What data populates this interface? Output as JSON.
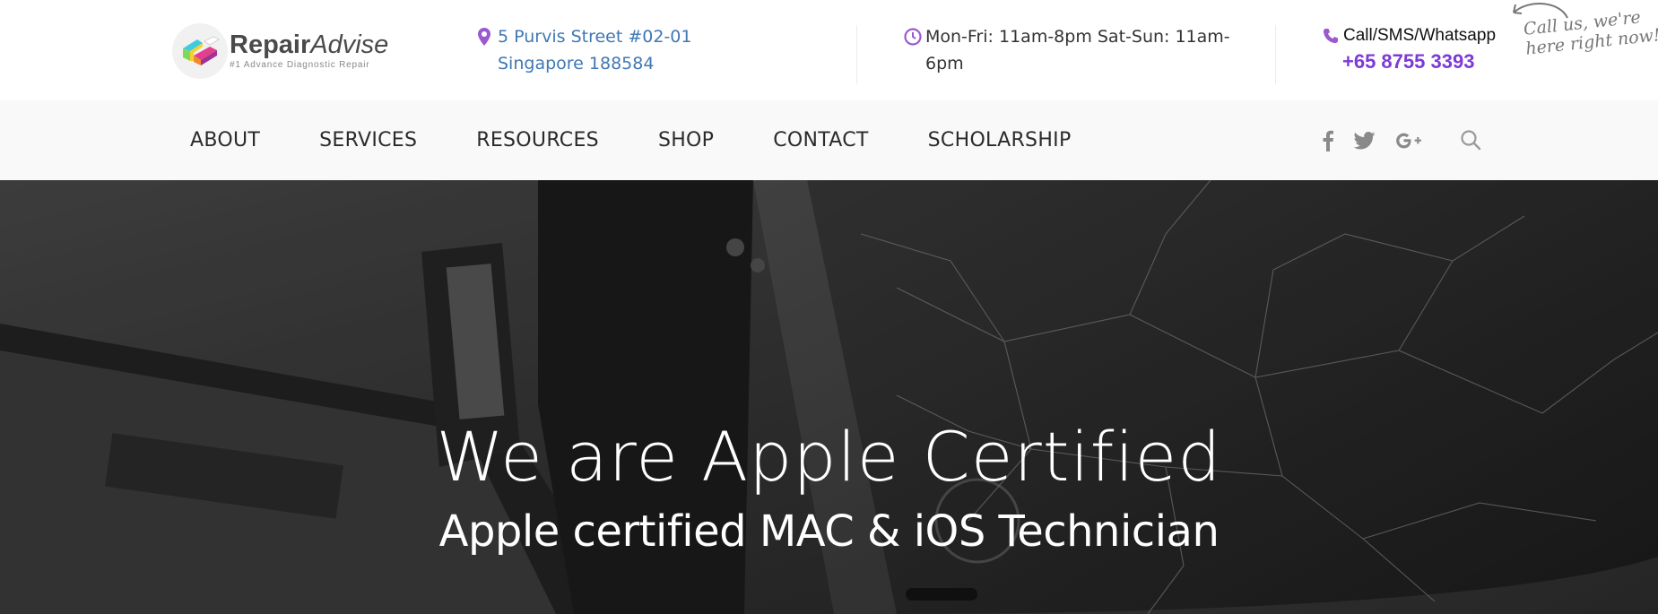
{
  "brand": {
    "name_bold": "Repair",
    "name_italic": "Advise",
    "tagline": "#1 Advance Diagnostic Repair"
  },
  "contact": {
    "address": "5 Purvis Street #02-01 Singapore 188584",
    "hours": "Mon-Fri: 11am-8pm Sat-Sun: 11am-6pm",
    "call_label": "Call/SMS/Whatsapp",
    "phone": "+65 8755 3393",
    "callout_line1": "Call us, we're",
    "callout_line2": "here right now!"
  },
  "nav": {
    "items": [
      "ABOUT",
      "SERVICES",
      "RESOURCES",
      "SHOP",
      "CONTACT",
      "SCHOLARSHIP"
    ]
  },
  "icons": {
    "location": "location-pin-icon",
    "clock": "clock-icon",
    "phone": "phone-icon",
    "social": [
      "facebook-icon",
      "twitter-icon",
      "google-plus-icon"
    ],
    "search": "search-icon"
  },
  "hero": {
    "title": "We are Apple Certified",
    "subtitle": "Apple certified MAC & iOS Technician"
  },
  "colors": {
    "accent": "#7d3bd6",
    "link": "#3f78b5",
    "nav_bg": "#f9f9f9"
  }
}
